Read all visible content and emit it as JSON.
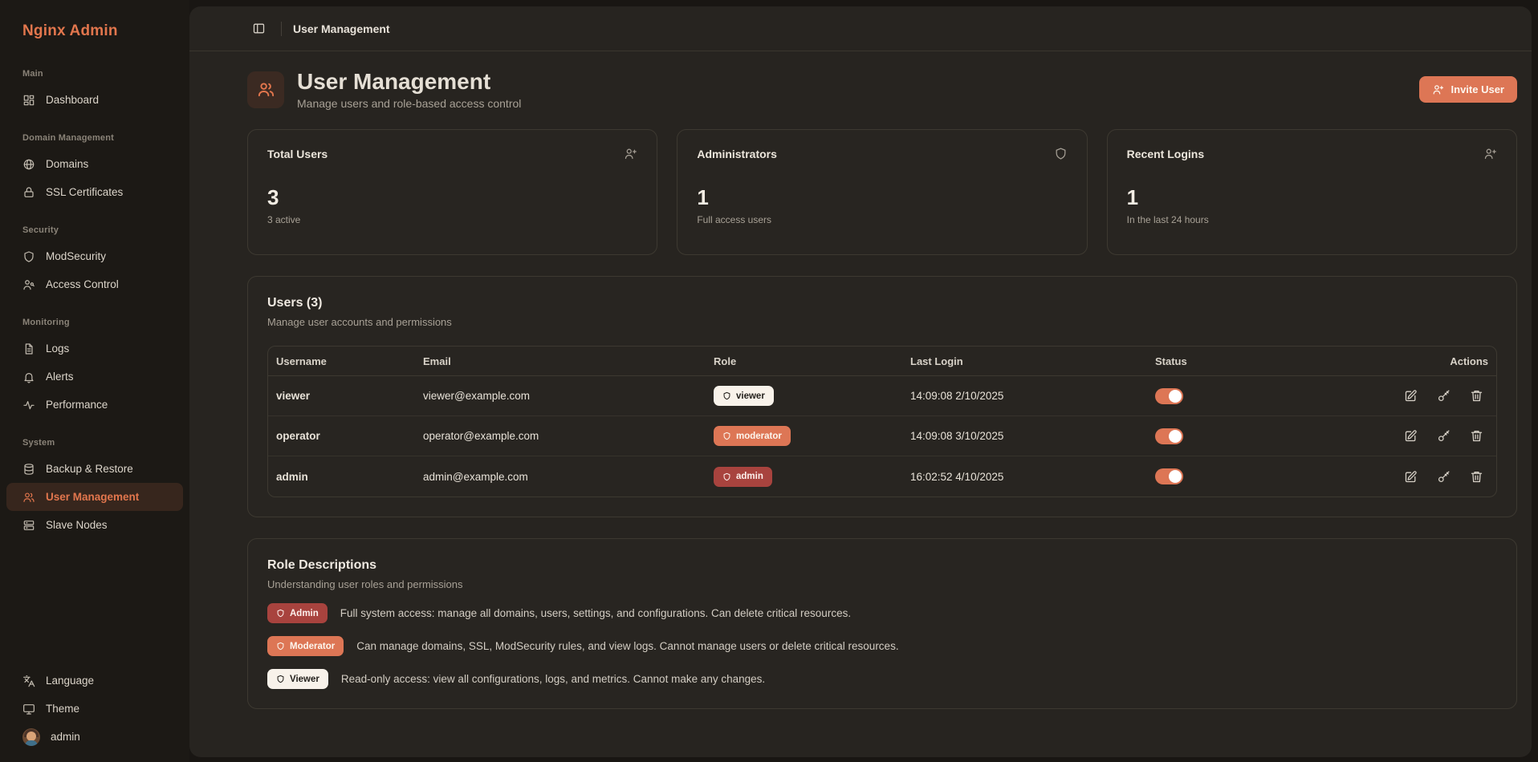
{
  "sidebar": {
    "logo": "Nginx Admin",
    "sections": [
      {
        "label": "Main",
        "items": [
          {
            "label": "Dashboard",
            "icon": "dashboard-icon"
          }
        ]
      },
      {
        "label": "Domain Management",
        "items": [
          {
            "label": "Domains",
            "icon": "globe-icon"
          },
          {
            "label": "SSL Certificates",
            "icon": "lock-icon"
          }
        ]
      },
      {
        "label": "Security",
        "items": [
          {
            "label": "ModSecurity",
            "icon": "shield-icon"
          },
          {
            "label": "Access Control",
            "icon": "user-key-icon"
          }
        ]
      },
      {
        "label": "Monitoring",
        "items": [
          {
            "label": "Logs",
            "icon": "file-text-icon"
          },
          {
            "label": "Alerts",
            "icon": "bell-icon"
          },
          {
            "label": "Performance",
            "icon": "activity-icon"
          }
        ]
      },
      {
        "label": "System",
        "items": [
          {
            "label": "Backup & Restore",
            "icon": "database-icon"
          },
          {
            "label": "User Management",
            "icon": "users-icon",
            "active": true
          },
          {
            "label": "Slave Nodes",
            "icon": "server-icon"
          }
        ]
      }
    ],
    "footer": [
      {
        "label": "Language",
        "icon": "languages-icon"
      },
      {
        "label": "Theme",
        "icon": "monitor-icon"
      },
      {
        "label": "admin",
        "icon": "avatar"
      }
    ]
  },
  "topbar": {
    "breadcrumb": "User Management",
    "toggle_icon": "panel-left-icon"
  },
  "page": {
    "title": "User Management",
    "subtitle": "Manage users and role-based access control",
    "invite_button": "Invite User"
  },
  "stats": [
    {
      "title": "Total Users",
      "icon": "user-plus-icon",
      "value": "3",
      "caption": "3 active"
    },
    {
      "title": "Administrators",
      "icon": "shield-icon",
      "value": "1",
      "caption": "Full access users"
    },
    {
      "title": "Recent Logins",
      "icon": "user-plus-icon",
      "value": "1",
      "caption": "In the last 24 hours"
    }
  ],
  "users_panel": {
    "title": "Users (3)",
    "subtitle": "Manage user accounts and permissions",
    "columns": [
      "Username",
      "Email",
      "Role",
      "Last Login",
      "Status",
      "Actions"
    ],
    "rows": [
      {
        "username": "viewer",
        "email": "viewer@example.com",
        "role": "viewer",
        "last_login": "14:09:08 2/10/2025",
        "status_on": true
      },
      {
        "username": "operator",
        "email": "operator@example.com",
        "role": "moderator",
        "last_login": "14:09:08 3/10/2025",
        "status_on": true
      },
      {
        "username": "admin",
        "email": "admin@example.com",
        "role": "admin",
        "last_login": "16:02:52 4/10/2025",
        "status_on": true
      }
    ],
    "row_actions": [
      "edit",
      "reset-key",
      "delete"
    ]
  },
  "roles_panel": {
    "title": "Role Descriptions",
    "subtitle": "Understanding user roles and permissions",
    "items": [
      {
        "badge": "Admin",
        "description": "Full system access: manage all domains, users, settings, and configurations. Can delete critical resources."
      },
      {
        "badge": "Moderator",
        "description": "Can manage domains, SSL, ModSecurity rules, and view logs. Cannot manage users or delete critical resources."
      },
      {
        "badge": "Viewer",
        "description": "Read-only access: view all configurations, logs, and metrics. Cannot make any changes."
      }
    ]
  },
  "colors": {
    "accent": "#dd7655",
    "admin_badge": "#a8433e",
    "moderator_badge": "#dd7655",
    "viewer_badge": "#f8f2ea",
    "sidebar_bg": "#1c1915",
    "main_bg": "#272420",
    "outer_bg": "#191613"
  }
}
